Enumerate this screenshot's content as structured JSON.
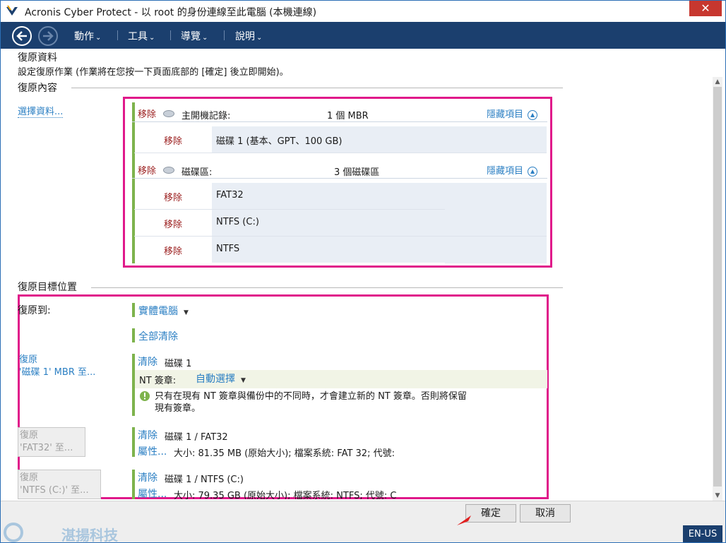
{
  "window": {
    "title": "Acronis Cyber Protect - 以 root 的身份連線至此電腦 (本機連線)",
    "close_glyph": "✕"
  },
  "toolbar": {
    "menus": [
      {
        "label": "動作"
      },
      {
        "label": "工具"
      },
      {
        "label": "導覽"
      },
      {
        "label": "說明"
      }
    ]
  },
  "page": {
    "title": "復原資料",
    "subtitle": "設定復原作業 (作業將在您按一下頁面底部的 [確定] 後立即開始)。"
  },
  "source": {
    "heading": "復原內容",
    "select_link": "選擇資料...",
    "remove_label": "移除",
    "hide_label": "隱藏項目",
    "groups": [
      {
        "name": "主開機記錄:",
        "count": "1 個 MBR",
        "rows": [
          {
            "value": "磁碟 1 (基本、GPT、100 GB)"
          }
        ]
      },
      {
        "name": "磁碟區:",
        "count": "3 個磁碟區",
        "rows": [
          {
            "value": "FAT32"
          },
          {
            "value": "NTFS (C:)"
          },
          {
            "value": "NTFS"
          }
        ]
      }
    ]
  },
  "target": {
    "heading": "復原目標位置",
    "recover_to_label": "復原到:",
    "recover_to_value": "實體電腦",
    "clear_all": "全部清除",
    "clear_label": "清除",
    "props_label": "屬性...",
    "items": [
      {
        "link_line1": "復原",
        "link_line2": "'磁碟 1' MBR 至...",
        "disk": "磁碟 1",
        "nt_signature_label": "NT 簽章:",
        "nt_signature_value": "自動選擇",
        "info_line1": "只有在現有 NT 簽章與備份中的不同時，才會建立新的 NT 簽章。否則將保留",
        "info_line2": "現有簽章。"
      },
      {
        "link_line1": "復原",
        "link_line2": "'FAT32' 至...",
        "disk": "磁碟 1 / FAT32",
        "details": "大小: 81.35 MB (原始大小); 檔案系統: FAT 32; 代號:"
      },
      {
        "link_line1": "復原",
        "link_line2": "'NTFS (C:)' 至...",
        "disk": "磁碟 1 / NTFS (C:)",
        "details": "大小: 79.35 GB (原始大小); 檔案系統: NTFS; 代號: C"
      }
    ]
  },
  "footer": {
    "ok": "確定",
    "cancel": "取消",
    "locale": "EN-US",
    "watermark": "湛揚科技"
  },
  "colors": {
    "accent": "#2b7fc3",
    "highlight": "#e0198a",
    "toolbar": "#1b3f6e",
    "group_bar": "#7eb34d"
  }
}
